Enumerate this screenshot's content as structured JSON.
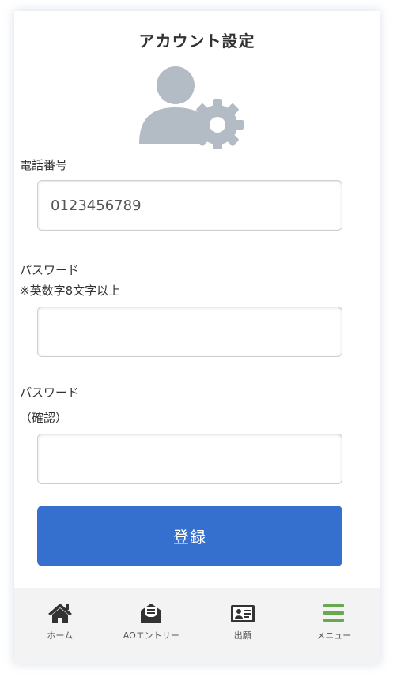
{
  "header": {
    "title": "アカウント設定",
    "icon": "user-settings-icon"
  },
  "form": {
    "phone": {
      "label": "電話番号",
      "value": "0123456789"
    },
    "password": {
      "label_line1": "パスワード",
      "label_line2": "※英数字8文字以上",
      "value": ""
    },
    "password_confirm": {
      "label_line1": "パスワード",
      "label_line2": "（確認）",
      "value": ""
    },
    "submit_label": "登録"
  },
  "bottom_nav": {
    "items": [
      {
        "label": "ホーム",
        "icon": "home-icon"
      },
      {
        "label": "AOエントリー",
        "icon": "mail-icon"
      },
      {
        "label": "出願",
        "icon": "id-card-icon"
      },
      {
        "label": "メニュー",
        "icon": "menu-icon"
      }
    ]
  },
  "colors": {
    "accent": "#3570cf",
    "menu_icon": "#6aa84f",
    "icon_gray": "#b3bcc4",
    "nav_icon": "#333333"
  }
}
